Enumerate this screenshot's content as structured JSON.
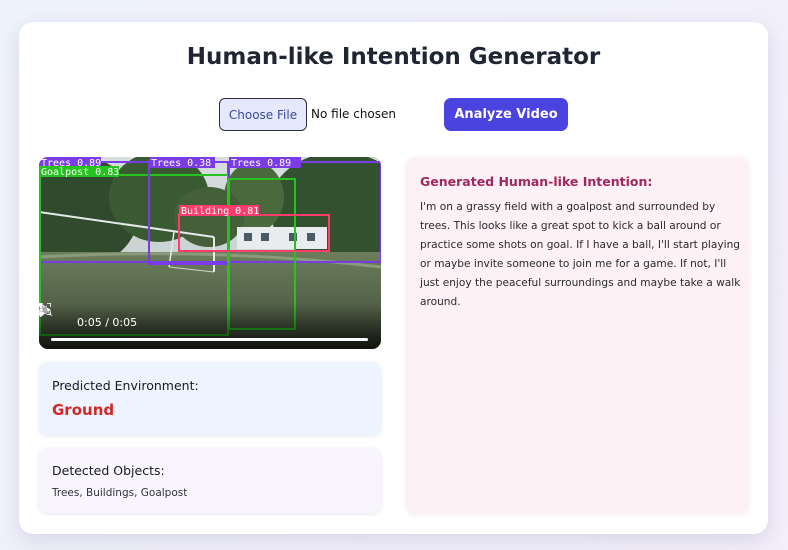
{
  "title": "Human-like Intention Generator",
  "upload": {
    "choose_file_label": "Choose File",
    "file_status": "No file chosen",
    "analyze_label": "Analyze Video"
  },
  "video": {
    "time": "0:05 / 0:05",
    "detections": [
      {
        "label": "Trees 0.89",
        "color": "#7a3ce6"
      },
      {
        "label": "Goalpost 0.83",
        "color": "#26c21f"
      },
      {
        "label": "Trees 0.38",
        "color": "#7a3ce6"
      },
      {
        "label": "Trees 0.89",
        "color": "#7a3ce6"
      },
      {
        "label": "Building 0.81",
        "color": "#ff3b6b"
      }
    ]
  },
  "environment": {
    "label": "Predicted Environment:",
    "value": "Ground"
  },
  "objects": {
    "label": "Detected Objects:",
    "value": "Trees, Buildings, Goalpost"
  },
  "intention": {
    "label": "Generated Human-like Intention:",
    "text": "I'm on a grassy field with a goalpost and surrounded by trees. This looks like a great spot to kick a ball around or practice some shots on goal. If I have a ball, I'll start playing or maybe invite someone to join me for a game. If not, I'll just enjoy the peaceful surroundings and maybe take a walk around."
  },
  "colors": {
    "accent": "#4a43e0",
    "environment_value": "#d42828",
    "intention_label": "#a0265f"
  }
}
